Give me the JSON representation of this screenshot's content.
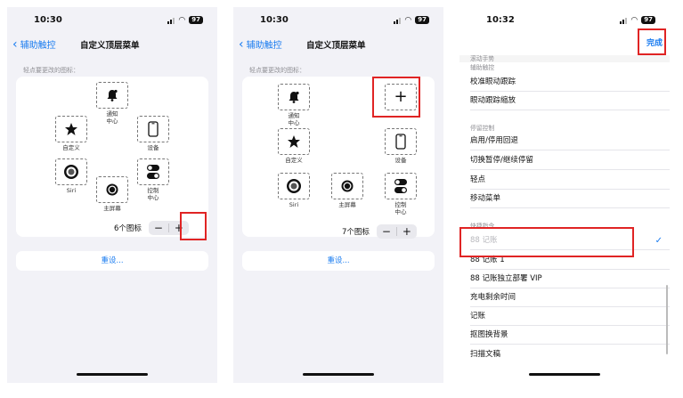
{
  "colors": {
    "accent": "#1a7cf0",
    "highlight": "#e02424"
  },
  "screen1": {
    "time": "10:30",
    "battery": "97",
    "back_label": "辅助触控",
    "title": "自定义顶层菜单",
    "hint": "轻点要更改的图标：",
    "icons": [
      {
        "name": "notification",
        "label": "通知\n中心",
        "icon": "bell-icon"
      },
      {
        "name": "custom",
        "label": "自定义",
        "icon": "star-icon"
      },
      {
        "name": "device",
        "label": "设备",
        "icon": "phone-icon"
      },
      {
        "name": "siri",
        "label": "Siri",
        "icon": "siri-icon"
      },
      {
        "name": "home",
        "label": "主屏幕",
        "icon": "home-button-icon"
      },
      {
        "name": "control",
        "label": "控制\n中心",
        "icon": "toggle-icon"
      }
    ],
    "count_label": "6个图标",
    "minus": "−",
    "plus": "+",
    "reset": "重设..."
  },
  "screen2": {
    "time": "10:30",
    "battery": "97",
    "back_label": "辅助触控",
    "title": "自定义顶层菜单",
    "hint": "轻点要更改的图标：",
    "icons": [
      {
        "name": "notification",
        "label": "通知\n中心",
        "icon": "bell-icon"
      },
      {
        "name": "new-slot",
        "label": "",
        "icon": "plus-icon"
      },
      {
        "name": "custom",
        "label": "自定义",
        "icon": "star-icon"
      },
      {
        "name": "device",
        "label": "设备",
        "icon": "phone-icon"
      },
      {
        "name": "siri",
        "label": "Siri",
        "icon": "siri-icon"
      },
      {
        "name": "home",
        "label": "主屏幕",
        "icon": "home-button-icon"
      },
      {
        "name": "control",
        "label": "控制\n中心",
        "icon": "toggle-icon"
      }
    ],
    "count_label": "7个图标",
    "minus": "−",
    "plus": "+",
    "reset": "重设..."
  },
  "screen3": {
    "time": "10:32",
    "battery": "97",
    "done": "完成",
    "top_items": [
      "滚动手势",
      "辅助触控"
    ],
    "group1": [
      "校准眼动跟踪",
      "眼动跟踪缩放"
    ],
    "group2_header": "停留控制",
    "group2": [
      "启用/停用回退",
      "切换暂停/继续停留",
      "轻点",
      "移动菜单"
    ],
    "group3_header": "快捷指令",
    "group3": [
      "88 记账",
      "88 记账 1",
      "88 记账独立部署 VIP",
      "充电剩余时间",
      "记账",
      "抠图换背景",
      "扫描文稿"
    ],
    "check": "✓"
  }
}
